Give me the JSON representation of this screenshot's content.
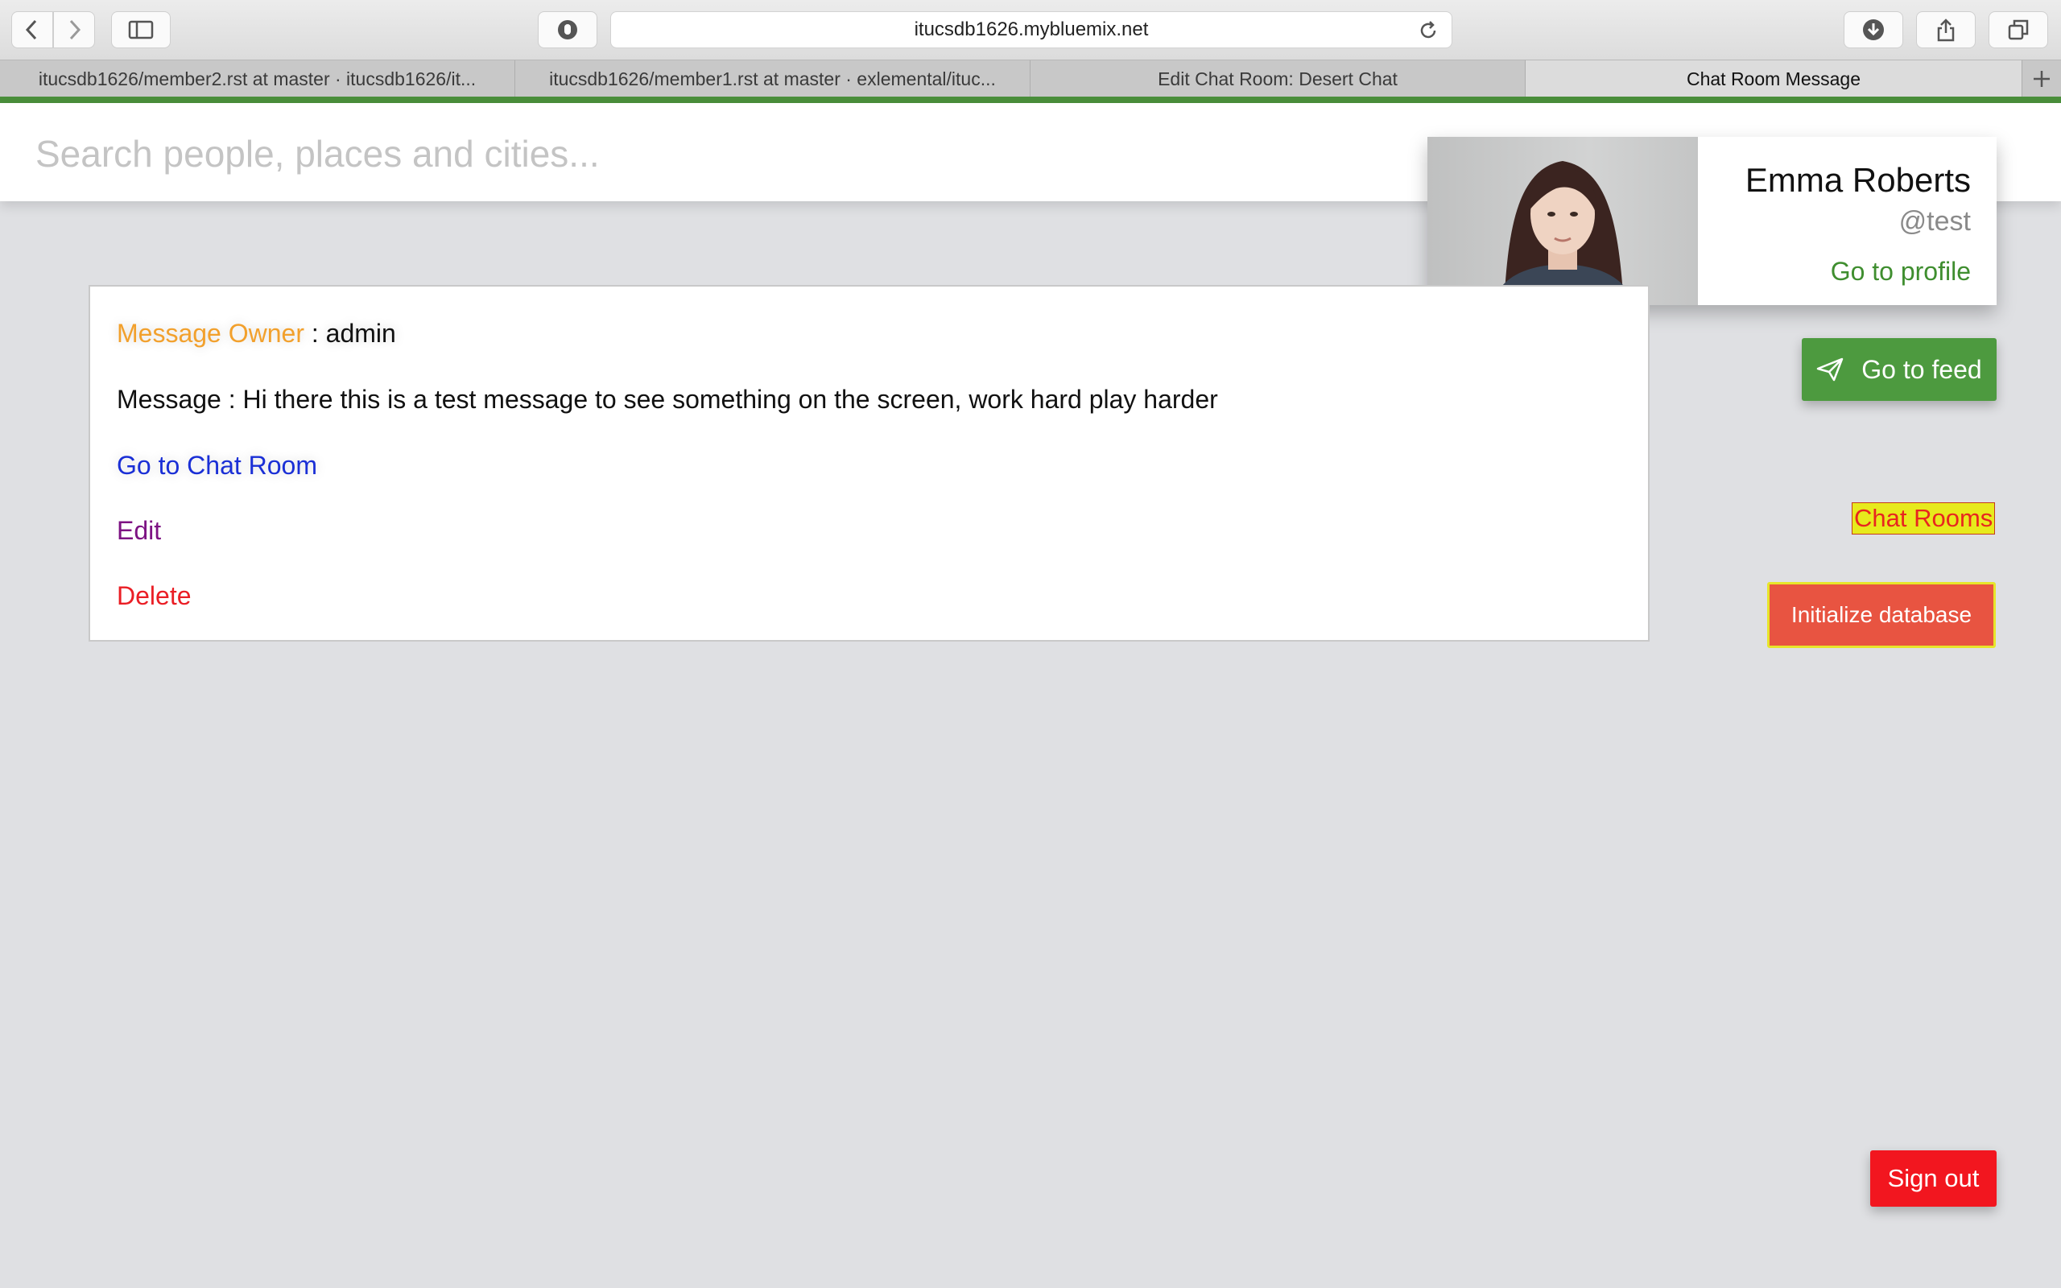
{
  "browser": {
    "url": "itucsdb1626.mybluemix.net",
    "tabs": [
      {
        "title": "itucsdb1626/member2.rst at master · itucsdb1626/it..."
      },
      {
        "title": "itucsdb1626/member1.rst at master · exlemental/ituc..."
      },
      {
        "title": "Edit Chat Room: Desert Chat"
      },
      {
        "title": "Chat Room Message"
      }
    ],
    "active_tab": 3,
    "accent_color": "#4a8f3b"
  },
  "search": {
    "placeholder": "Search people, places and cities...",
    "value": ""
  },
  "profile": {
    "name": "Emma Roberts",
    "handle": "@test",
    "link_label": "Go to profile"
  },
  "actions": {
    "feed_label": "Go to feed",
    "chat_rooms_label": "Chat Rooms",
    "init_db_label": "Initialize database",
    "sign_out_label": "Sign out"
  },
  "message": {
    "owner_label": "Message Owner",
    "owner_value": " : admin",
    "text": "Message : Hi there this is a test message to see something on the screen, work hard play harder",
    "chat_room_link": "Go to Chat Room",
    "edit_link": "Edit",
    "delete_link": "Delete"
  },
  "colors": {
    "feed": "#4d9a3f",
    "init_db": "#e85441",
    "sign_out": "#f2161f",
    "chat_rooms_bg": "#e7ea1c"
  }
}
